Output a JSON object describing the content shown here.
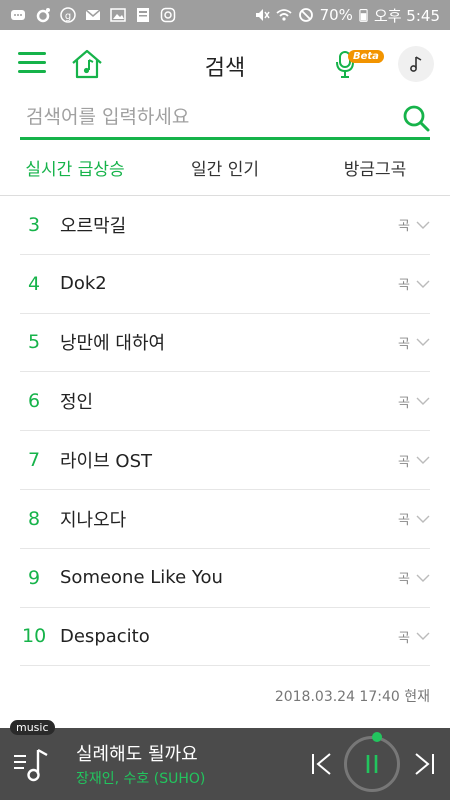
{
  "status_bar": {
    "battery": "70%",
    "time": "오후 5:45"
  },
  "header": {
    "title": "검색",
    "beta_badge": "Beta"
  },
  "search": {
    "placeholder": "검색어를 입력하세요"
  },
  "tabs": [
    {
      "label": "실시간 급상승",
      "active": true
    },
    {
      "label": "일간 인기",
      "active": false
    },
    {
      "label": "방금그곡",
      "active": false
    }
  ],
  "ranking": [
    {
      "rank": "3",
      "term": "오르막길",
      "kind": "곡"
    },
    {
      "rank": "4",
      "term": "Dok2",
      "kind": "곡"
    },
    {
      "rank": "5",
      "term": "낭만에 대하여",
      "kind": "곡"
    },
    {
      "rank": "6",
      "term": "정인",
      "kind": "곡"
    },
    {
      "rank": "7",
      "term": "라이브 OST",
      "kind": "곡"
    },
    {
      "rank": "8",
      "term": "지나오다",
      "kind": "곡"
    },
    {
      "rank": "9",
      "term": "Someone Like You",
      "kind": "곡"
    },
    {
      "rank": "10",
      "term": "Despacito",
      "kind": "곡"
    }
  ],
  "timestamp": "2018.03.24 17:40 현재",
  "player": {
    "tag": "music",
    "song_title": "실례해도 될까요",
    "artist": "장재인, 수호 (SUHO)"
  },
  "colors": {
    "accent": "#16b34a",
    "player_bg": "#4b4b4b",
    "status_bg": "#9e9e9e"
  }
}
